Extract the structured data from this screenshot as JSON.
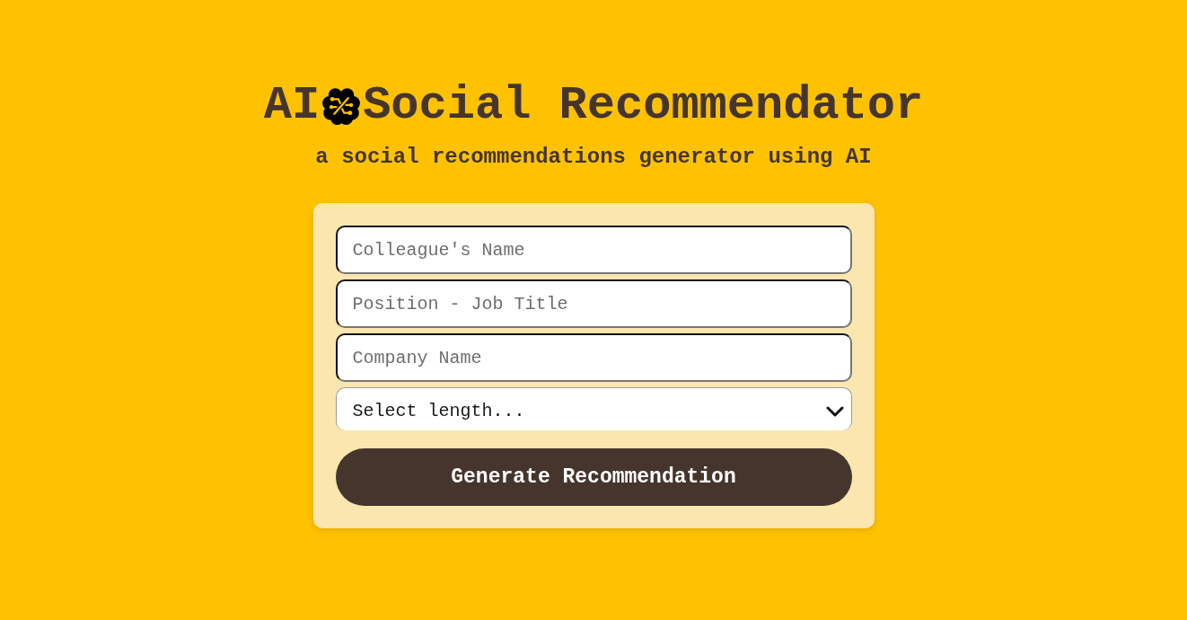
{
  "header": {
    "title_start": "AI",
    "title_end": "Social Recommendator",
    "subtitle": "a social recommendations generator using AI"
  },
  "form": {
    "fields": [
      {
        "kind": "text",
        "placeholder": "Colleague's Name"
      },
      {
        "kind": "text",
        "placeholder": "Position - Job Title"
      },
      {
        "kind": "text",
        "placeholder": "Company Name"
      },
      {
        "kind": "select",
        "value": "Select length..."
      }
    ],
    "button": "Generate Recommendation"
  }
}
